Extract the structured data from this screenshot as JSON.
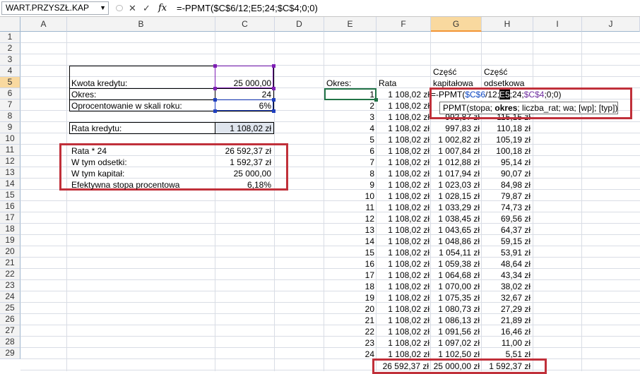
{
  "formula_bar": {
    "name_box": "WART.PRZYSZŁ.KAP",
    "formula": "=-PPMT($C$6/12;E5;24;$C$4;0;0)",
    "cancel_icon": "✕",
    "enter_icon": "✓",
    "fx_icon": "fx"
  },
  "columns": [
    "A",
    "B",
    "C",
    "D",
    "E",
    "F",
    "G",
    "H",
    "I",
    "J"
  ],
  "rows": [
    "1",
    "2",
    "3",
    "4",
    "5",
    "6",
    "7",
    "8",
    "9",
    "10",
    "11",
    "12",
    "13",
    "14",
    "15",
    "16",
    "17",
    "18",
    "19",
    "20",
    "21",
    "22",
    "23",
    "24",
    "25",
    "26",
    "27",
    "28",
    "29"
  ],
  "left_table": {
    "kwota_label": "Kwota kredytu:",
    "kwota_value": "25 000,00",
    "okres_label": "Okres:",
    "okres_value": "24",
    "oproc_label": "Oprocentowanie w skali roku:",
    "oproc_value": "6%",
    "rata_label": "Rata kredytu:",
    "rata_value": "1 108,02 zł"
  },
  "summary_table": {
    "rows": [
      {
        "label": "Rata * 24",
        "value": "26 592,37 zł"
      },
      {
        "label": "W tym odsetki:",
        "value": "1 592,37 zł"
      },
      {
        "label": "W tym kapitał:",
        "value": "25 000,00"
      },
      {
        "label": "Efektywna stopa procentowa",
        "value": "6,18%"
      }
    ]
  },
  "schedule": {
    "header_okres": "Okres:",
    "header_rata": "Rata",
    "header_kap_1": "Część",
    "header_kap_2": "kapitałowa",
    "header_ods_1": "Część",
    "header_ods_2": "odsetkowa",
    "rows": [
      {
        "okres": "1",
        "rata": "1 108,02 zł",
        "kap": "",
        "ods": ""
      },
      {
        "okres": "2",
        "rata": "1 108,02 zł",
        "kap": "",
        "ods": ""
      },
      {
        "okres": "3",
        "rata": "1 108,02 zł",
        "kap": "992,87 zł",
        "ods": "115,15 zł"
      },
      {
        "okres": "4",
        "rata": "1 108,02 zł",
        "kap": "997,83 zł",
        "ods": "110,18 zł"
      },
      {
        "okres": "5",
        "rata": "1 108,02 zł",
        "kap": "1 002,82 zł",
        "ods": "105,19 zł"
      },
      {
        "okres": "6",
        "rata": "1 108,02 zł",
        "kap": "1 007,84 zł",
        "ods": "100,18 zł"
      },
      {
        "okres": "7",
        "rata": "1 108,02 zł",
        "kap": "1 012,88 zł",
        "ods": "95,14 zł"
      },
      {
        "okres": "8",
        "rata": "1 108,02 zł",
        "kap": "1 017,94 zł",
        "ods": "90,07 zł"
      },
      {
        "okres": "9",
        "rata": "1 108,02 zł",
        "kap": "1 023,03 zł",
        "ods": "84,98 zł"
      },
      {
        "okres": "10",
        "rata": "1 108,02 zł",
        "kap": "1 028,15 zł",
        "ods": "79,87 zł"
      },
      {
        "okres": "11",
        "rata": "1 108,02 zł",
        "kap": "1 033,29 zł",
        "ods": "74,73 zł"
      },
      {
        "okres": "12",
        "rata": "1 108,02 zł",
        "kap": "1 038,45 zł",
        "ods": "69,56 zł"
      },
      {
        "okres": "13",
        "rata": "1 108,02 zł",
        "kap": "1 043,65 zł",
        "ods": "64,37 zł"
      },
      {
        "okres": "14",
        "rata": "1 108,02 zł",
        "kap": "1 048,86 zł",
        "ods": "59,15 zł"
      },
      {
        "okres": "15",
        "rata": "1 108,02 zł",
        "kap": "1 054,11 zł",
        "ods": "53,91 zł"
      },
      {
        "okres": "16",
        "rata": "1 108,02 zł",
        "kap": "1 059,38 zł",
        "ods": "48,64 zł"
      },
      {
        "okres": "17",
        "rata": "1 108,02 zł",
        "kap": "1 064,68 zł",
        "ods": "43,34 zł"
      },
      {
        "okres": "18",
        "rata": "1 108,02 zł",
        "kap": "1 070,00 zł",
        "ods": "38,02 zł"
      },
      {
        "okres": "19",
        "rata": "1 108,02 zł",
        "kap": "1 075,35 zł",
        "ods": "32,67 zł"
      },
      {
        "okres": "20",
        "rata": "1 108,02 zł",
        "kap": "1 080,73 zł",
        "ods": "27,29 zł"
      },
      {
        "okres": "21",
        "rata": "1 108,02 zł",
        "kap": "1 086,13 zł",
        "ods": "21,89 zł"
      },
      {
        "okres": "22",
        "rata": "1 108,02 zł",
        "kap": "1 091,56 zł",
        "ods": "16,46 zł"
      },
      {
        "okres": "23",
        "rata": "1 108,02 zł",
        "kap": "1 097,02 zł",
        "ods": "11,00 zł"
      },
      {
        "okres": "24",
        "rata": "1 108,02 zł",
        "kap": "1 102,50 zł",
        "ods": "5,51 zł"
      }
    ],
    "total_rata": "26 592,37 zł",
    "total_kap": "25 000,00 zł",
    "total_ods": "1 592,37 zł"
  },
  "edit_cell": {
    "prefix": "=-PPMT(",
    "arg1": "$C$6",
    "mid1": "/12;",
    "arg2": "E5",
    "mid2": ";24;",
    "arg3": "$C$4",
    "suffix": ";0;0)"
  },
  "tooltip": {
    "pre": "PPMT(stopa; ",
    "bold": "okres",
    "post": "; liczba_rat; wa; [wp]; [typ])"
  },
  "colors": {
    "highlight_red": "#c0303a",
    "selection_green": "#217346",
    "ref_purple": "#7030a0",
    "ref_blue": "#0d47c2"
  }
}
